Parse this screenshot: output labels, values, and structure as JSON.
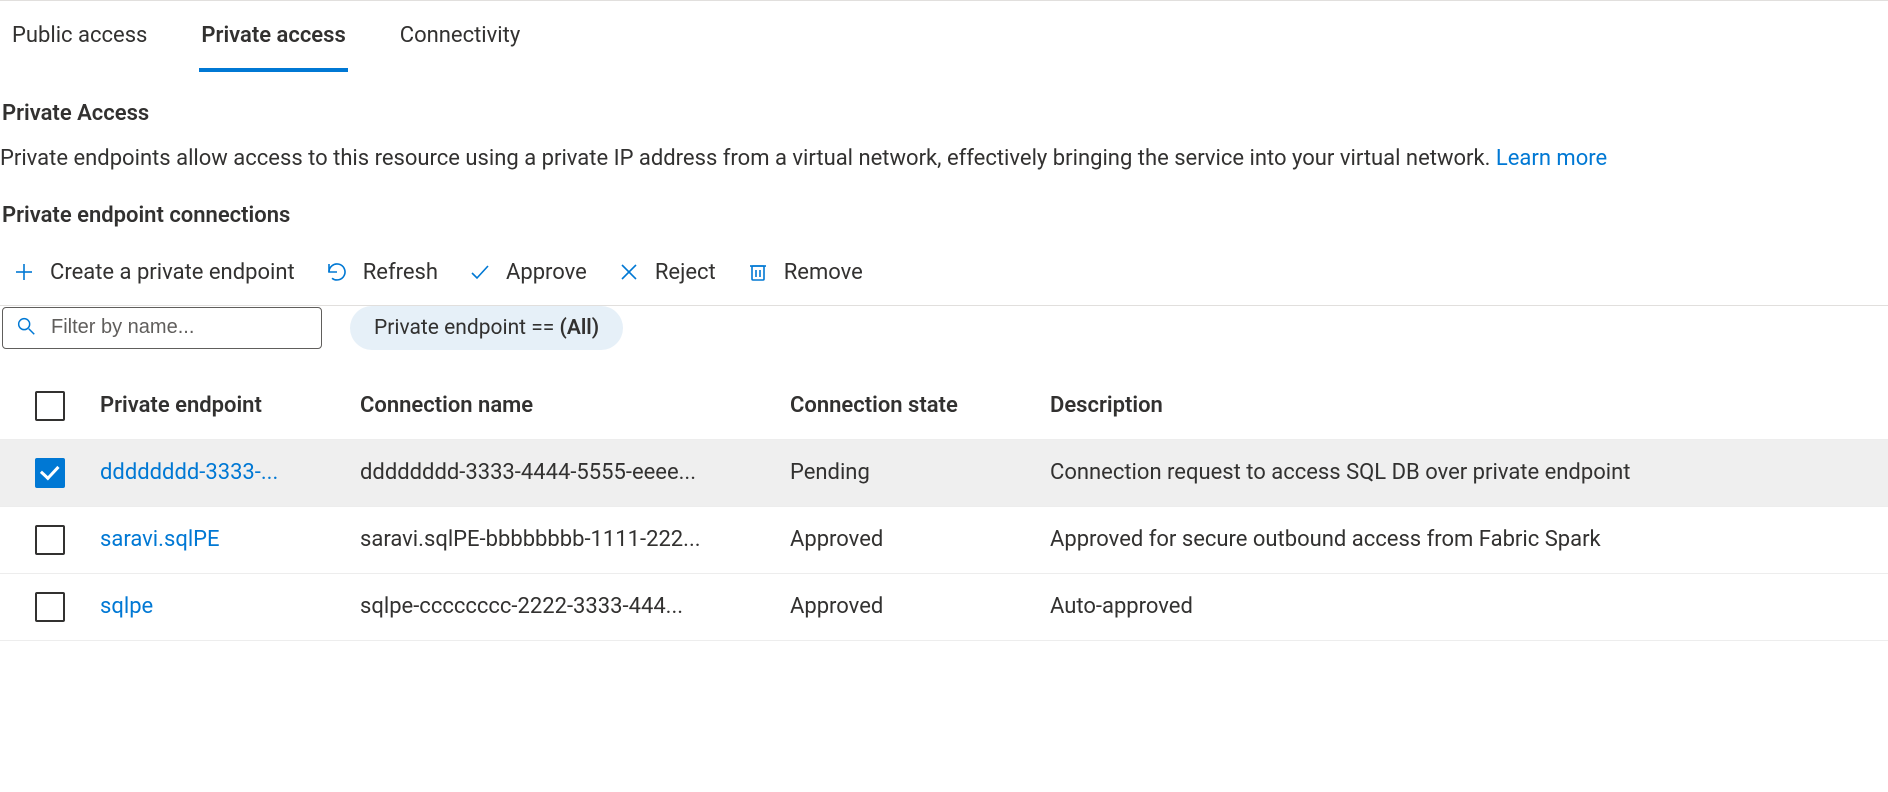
{
  "tabs": [
    {
      "label": "Public access",
      "active": false
    },
    {
      "label": "Private access",
      "active": true
    },
    {
      "label": "Connectivity",
      "active": false
    }
  ],
  "privateAccess": {
    "heading": "Private Access",
    "description": "Private endpoints allow access to this resource using a private IP address from a virtual network, effectively bringing the service into your virtual network. ",
    "learnMore": "Learn more"
  },
  "connections": {
    "heading": "Private endpoint connections",
    "toolbar": {
      "create": "Create a private endpoint",
      "refresh": "Refresh",
      "approve": "Approve",
      "reject": "Reject",
      "remove": "Remove"
    },
    "filter": {
      "placeholder": "Filter by name...",
      "pillPrefix": "Private endpoint == ",
      "pillValue": "(All)"
    },
    "columns": {
      "endpoint": "Private endpoint",
      "connName": "Connection name",
      "state": "Connection state",
      "description": "Description"
    },
    "rows": [
      {
        "checked": true,
        "endpoint": "dddddddd-3333-...",
        "connName": "dddddddd-3333-4444-5555-eeee...",
        "state": "Pending",
        "description": "Connection request to access SQL DB over private endpoint"
      },
      {
        "checked": false,
        "endpoint": "saravi.sqlPE",
        "connName": "saravi.sqlPE-bbbbbbbb-1111-222...",
        "state": "Approved",
        "description": "Approved for secure outbound access from Fabric Spark"
      },
      {
        "checked": false,
        "endpoint": "sqlpe",
        "connName": "sqlpe-cccccccc-2222-3333-444...",
        "state": "Approved",
        "description": "Auto-approved"
      }
    ]
  }
}
